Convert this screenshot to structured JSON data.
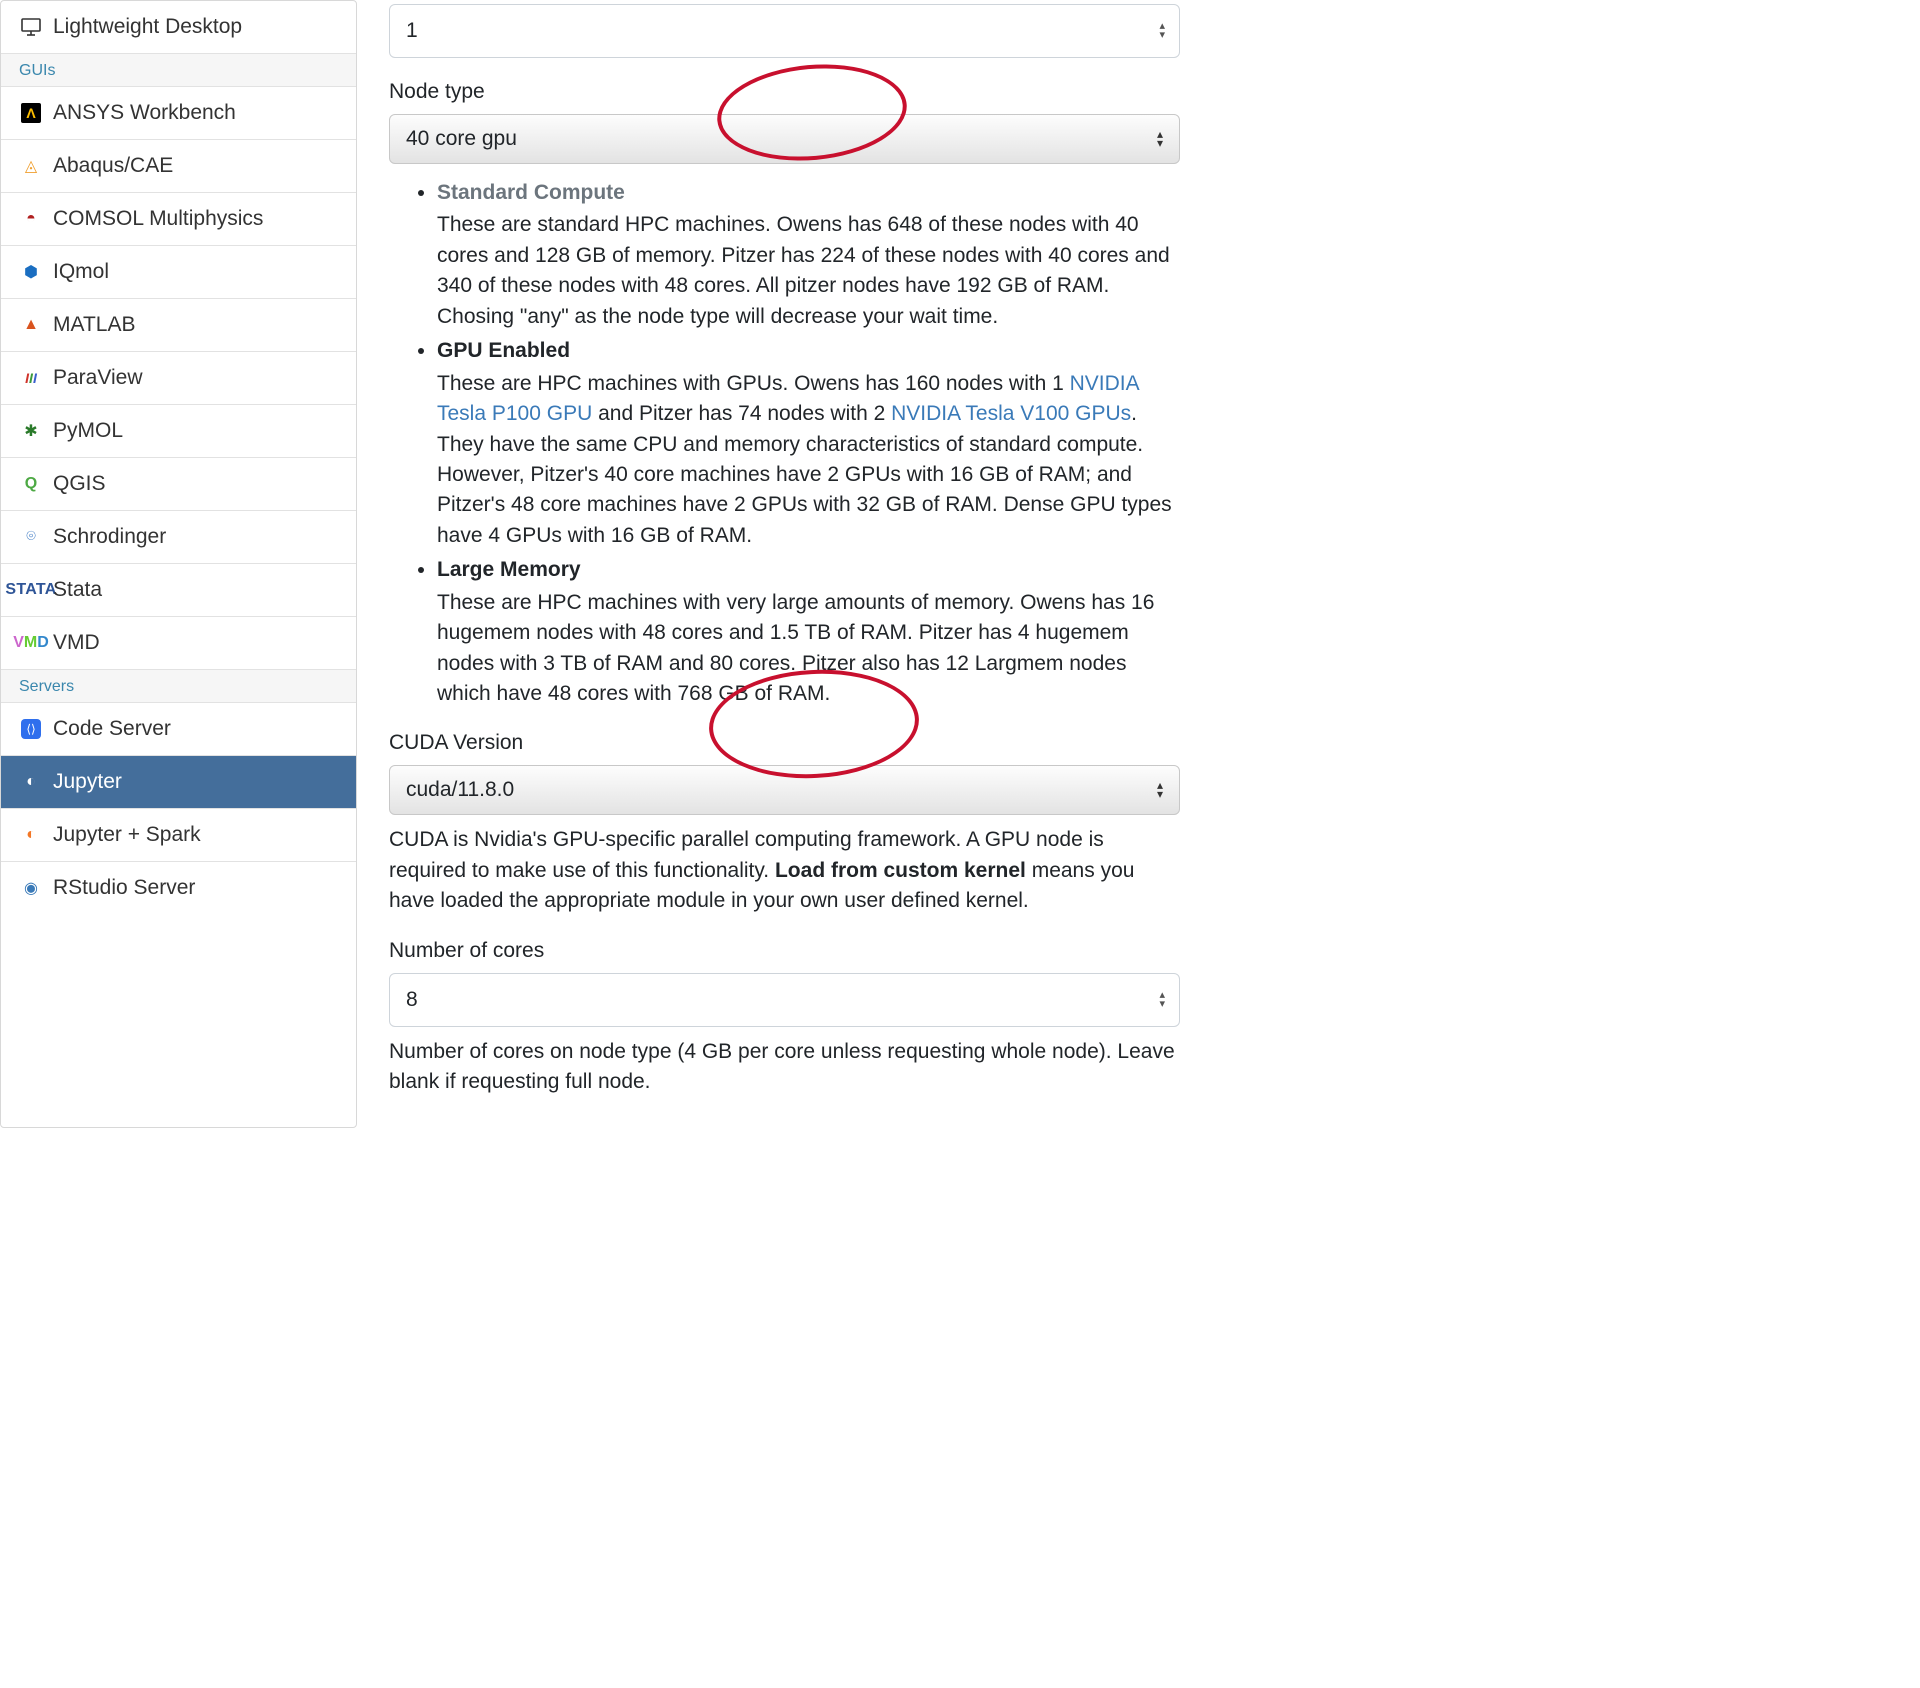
{
  "sidebar": {
    "items": [
      {
        "group": "desktops",
        "label": "Lightweight Desktop",
        "icon": "desktop-icon"
      }
    ],
    "section_guis": "GUIs",
    "guis": [
      {
        "label": "ANSYS Workbench",
        "icon": "ansys-icon"
      },
      {
        "label": "Abaqus/CAE",
        "icon": "abaqus-icon"
      },
      {
        "label": "COMSOL Multiphysics",
        "icon": "comsol-icon"
      },
      {
        "label": "IQmol",
        "icon": "iqmol-icon"
      },
      {
        "label": "MATLAB",
        "icon": "matlab-icon"
      },
      {
        "label": "ParaView",
        "icon": "paraview-icon"
      },
      {
        "label": "PyMOL",
        "icon": "pymol-icon"
      },
      {
        "label": "QGIS",
        "icon": "qgis-icon"
      },
      {
        "label": "Schrodinger",
        "icon": "schrodinger-icon"
      },
      {
        "label": "Stata",
        "icon": "stata-icon"
      },
      {
        "label": "VMD",
        "icon": "vmd-icon"
      }
    ],
    "section_servers": "Servers",
    "servers": [
      {
        "label": "Code Server",
        "icon": "codeserver-icon"
      },
      {
        "label": "Jupyter",
        "icon": "jupyter-icon",
        "active": true
      },
      {
        "label": "Jupyter + Spark",
        "icon": "jupyter-icon"
      },
      {
        "label": "RStudio Server",
        "icon": "rstudio-icon"
      }
    ]
  },
  "form": {
    "field_top_value": "1",
    "node_type_label": "Node type",
    "node_type_value": "40 core gpu",
    "desc": {
      "standard_title": "Standard Compute",
      "standard_text": "These are standard HPC machines. Owens has 648 of these nodes with 40 cores and 128 GB of memory. Pitzer has 224 of these nodes with 40 cores and 340 of these nodes with 48 cores. All pitzer nodes have 192 GB of RAM. Chosing \"any\" as the node type will decrease your wait time.",
      "gpu_title": "GPU Enabled",
      "gpu_text_1": "These are HPC machines with GPUs. Owens has 160 nodes with 1 ",
      "gpu_link_1": "NVIDIA Tesla P100 GPU",
      "gpu_text_2": " and Pitzer has 74 nodes with 2 ",
      "gpu_link_2": "NVIDIA Tesla V100 GPUs",
      "gpu_text_3": ". They have the same CPU and memory characteristics of standard compute. However, Pitzer's 40 core machines have 2 GPUs with 16 GB of RAM; and Pitzer's 48 core machines have 2 GPUs with 32 GB of RAM. Dense GPU types have 4 GPUs with 16 GB of RAM.",
      "largemem_title": "Large Memory",
      "largemem_text": "These are HPC machines with very large amounts of memory. Owens has 16 hugemem nodes with 48 cores and 1.5 TB of RAM. Pitzer has 4 hugemem nodes with 3 TB of RAM and 80 cores. Pitzer also has 12 Largmem nodes which have 48 cores with 768 GB of RAM."
    },
    "cuda_label": "CUDA Version",
    "cuda_value": "cuda/11.8.0",
    "cuda_help_1": "CUDA is Nvidia's GPU-specific parallel computing framework. A GPU node is required to make use of this functionality. ",
    "cuda_help_bold": "Load from custom kernel",
    "cuda_help_2": " means you have loaded the appropriate module in your own user defined kernel.",
    "cores_label": "Number of cores",
    "cores_value": "8",
    "cores_help": "Number of cores on node type (4 GB per core unless requesting whole node). Leave blank if requesting full node."
  }
}
